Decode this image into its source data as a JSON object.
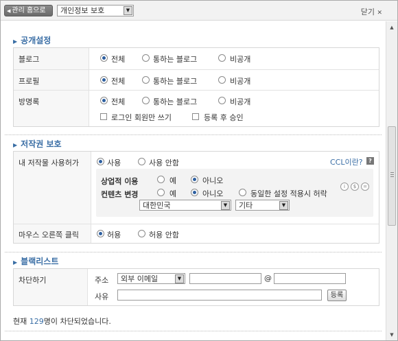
{
  "topbar": {
    "home_label": "관리 홈으로",
    "section_select": "개인정보 보호",
    "close_label": "닫기"
  },
  "public_settings": {
    "title": "공개설정",
    "rows": [
      {
        "label": "블로그",
        "options": [
          "전체",
          "통하는 블로그",
          "비공개"
        ],
        "selected": "전체"
      },
      {
        "label": "프로필",
        "options": [
          "전체",
          "통하는 블로그",
          "비공개"
        ],
        "selected": "전체"
      },
      {
        "label": "방명록",
        "options": [
          "전체",
          "통하는 블로그",
          "비공개"
        ],
        "selected": "전체",
        "checkboxes": [
          "로그인 회원만 쓰기",
          "등록 후 승인"
        ]
      }
    ]
  },
  "copyright": {
    "title": "저작권 보호",
    "permit_label": "내 저작물 사용허가",
    "permit_options": [
      "사용",
      "사용 안함"
    ],
    "permit_selected": "사용",
    "ccl_link": "CCL이란?",
    "help_icon": "?",
    "commercial_label": "상업적 이용",
    "commercial_options": [
      "예",
      "아니오"
    ],
    "commercial_selected": "아니오",
    "modify_label": "컨텐츠 변경",
    "modify_options": [
      "예",
      "아니오",
      "동일한 설정 적용시 허락"
    ],
    "modify_selected": "아니오",
    "country_select": "대한민국",
    "other_select": "기타",
    "license_icons": [
      "info-circle-icon",
      "no-commercial-icon",
      "equal-icon"
    ],
    "rightclick_label": "마우스 오른쪽 클릭",
    "rightclick_options": [
      "허용",
      "허용 안함"
    ],
    "rightclick_selected": "허용"
  },
  "blacklist": {
    "title": "블랙리스트",
    "block_label": "차단하기",
    "address_label": "주소",
    "address_type_select": "외부 이메일",
    "at_sign": "@",
    "reason_label": "사유",
    "register_button": "등록",
    "status_prefix": "현재 ",
    "status_count": "129",
    "status_suffix": "명이 차단되었습니다."
  },
  "colors": {
    "accent": "#3a6ea5",
    "label_bg": "#f7f7f7",
    "inner_bg": "#f3f3f3"
  }
}
